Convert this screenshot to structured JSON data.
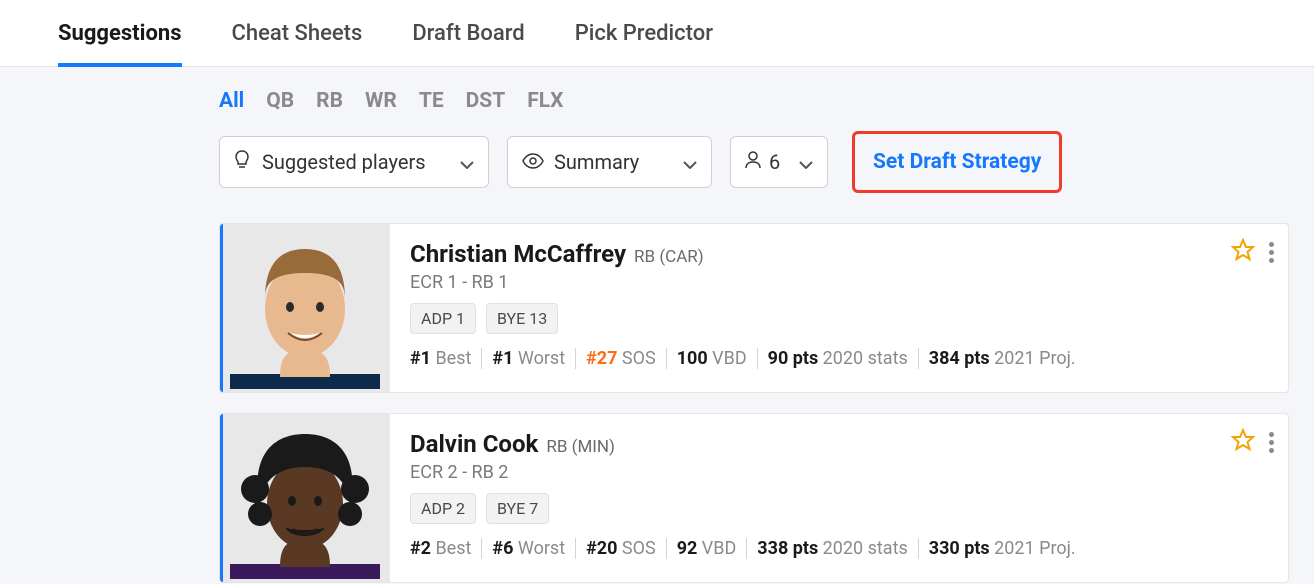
{
  "nav": {
    "tabs": [
      {
        "label": "Suggestions",
        "active": true
      },
      {
        "label": "Cheat Sheets",
        "active": false
      },
      {
        "label": "Draft Board",
        "active": false
      },
      {
        "label": "Pick Predictor",
        "active": false
      }
    ]
  },
  "pos_filter": [
    {
      "label": "All",
      "active": true
    },
    {
      "label": "QB",
      "active": false
    },
    {
      "label": "RB",
      "active": false
    },
    {
      "label": "WR",
      "active": false
    },
    {
      "label": "TE",
      "active": false
    },
    {
      "label": "DST",
      "active": false
    },
    {
      "label": "FLX",
      "active": false
    }
  ],
  "controls": {
    "suggested": "Suggested players",
    "view": "Summary",
    "count": "6",
    "strategy_label": "Set Draft Strategy"
  },
  "players": [
    {
      "name": "Christian McCaffrey",
      "pos_team": "RB (CAR)",
      "ecr_line": "ECR 1 - RB 1",
      "badges": [
        "ADP 1",
        "BYE 13"
      ],
      "stats": {
        "best_rank": "#1",
        "best_label": "Best",
        "worst_rank": "#1",
        "worst_label": "Worst",
        "sos_rank": "#27",
        "sos_label": "SOS",
        "sos_hot": true,
        "vbd_val": "100",
        "vbd_label": "VBD",
        "pts1_val": "90 pts",
        "pts1_label": "2020 stats",
        "pts2_val": "384 pts",
        "pts2_label": "2021 Proj."
      },
      "skin": "#e8b98f",
      "hair": "#9a6b3a"
    },
    {
      "name": "Dalvin Cook",
      "pos_team": "RB (MIN)",
      "ecr_line": "ECR 2 - RB 2",
      "badges": [
        "ADP 2",
        "BYE 7"
      ],
      "stats": {
        "best_rank": "#2",
        "best_label": "Best",
        "worst_rank": "#6",
        "worst_label": "Worst",
        "sos_rank": "#20",
        "sos_label": "SOS",
        "sos_hot": false,
        "vbd_val": "92",
        "vbd_label": "VBD",
        "pts1_val": "338 pts",
        "pts1_label": "2020 stats",
        "pts2_val": "330 pts",
        "pts2_label": "2021 Proj."
      },
      "skin": "#5a3924",
      "hair": "#1a1a1a"
    }
  ]
}
